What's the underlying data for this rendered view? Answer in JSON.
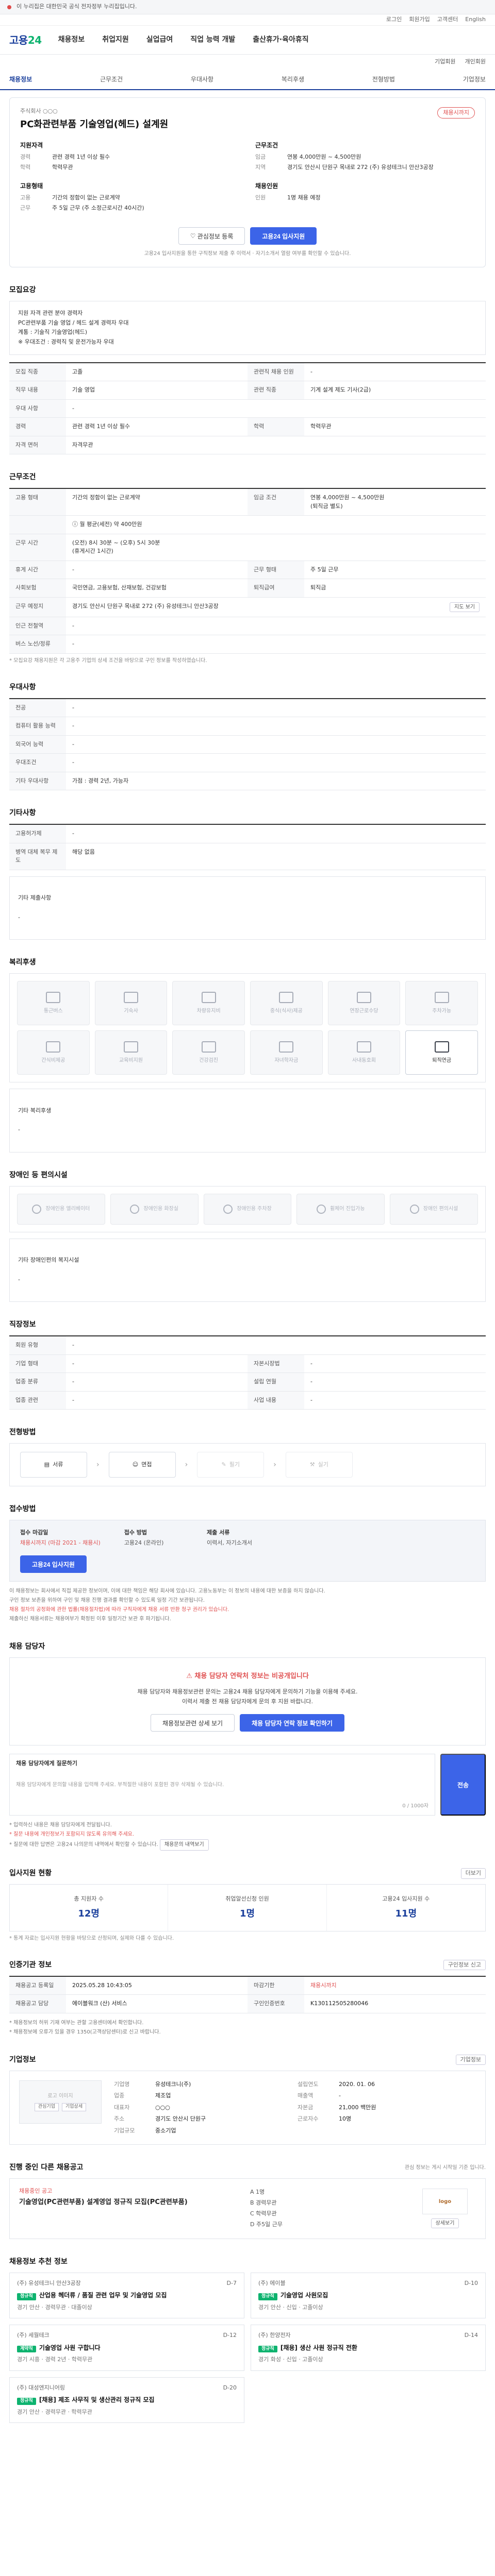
{
  "topbar": {
    "text": "이 누리집은 대한민국 공식 전자정부 누리집입니다."
  },
  "util": [
    "로그인",
    "회원가입",
    "고객센터",
    "English"
  ],
  "header": {
    "logo_main": "고용",
    "logo_accent": "24",
    "gnb": [
      "채용정보",
      "취업지원",
      "실업급여",
      "직업 능력 개발",
      "출산휴가·육아휴직"
    ]
  },
  "search": [
    "기업회원",
    "개인회원"
  ],
  "tabs": [
    "채용정보",
    "근무조건",
    "우대사항",
    "복리후생",
    "전형방법",
    "기업정보"
  ],
  "headline": {
    "company": "주식회사 ○○○",
    "title": "PC화관련부품 기술영업(헤드) 설계원",
    "dday": "채용시까지",
    "blocks": [
      {
        "title": "지원자격",
        "rows": [
          {
            "k": "경력",
            "v": "관련 경력 1년 이상 필수"
          },
          {
            "k": "학력",
            "v": "학력무관"
          }
        ]
      },
      {
        "title": "근무조건",
        "rows": [
          {
            "k": "임금",
            "v": "연봉 4,000만원 ~ 4,500만원"
          },
          {
            "k": "지역",
            "v": "경기도 안산시 단원구 목내로 272 (주) 유성테크니 안산3공장"
          }
        ]
      },
      {
        "title": "고용형태",
        "rows": [
          {
            "k": "고용",
            "v": "기간의 정함이 없는 근로계약"
          },
          {
            "k": "근무",
            "v": "주 5일 근무 (주 소정근로시간 40시간)"
          }
        ]
      },
      {
        "title": "채용인원",
        "rows": [
          {
            "k": "인원",
            "v": "1명 채용 예정"
          }
        ]
      }
    ],
    "actions": {
      "save": "관심정보 등록",
      "apply": "고용24 입사지원"
    },
    "note": "고용24 입사지원을 통한 구직정보 제출 후 이력서 · 자기소개서 열람 여부를 확인할 수 있습니다."
  },
  "job_desc": {
    "title": "모집요강",
    "text": "지원 자격 관련 분야 경력자\nPC관련부품 기술 영업 / 헤드 설계 경력자 우대\n계통 : 기술직 기술영업(헤드)\n※ 우대조건 : 경력직 및 운전가능자 우대",
    "rows": [
      {
        "th": "모집 직종",
        "td": "고졸",
        "th2": "관련직 채용 인원",
        "td2": "-"
      },
      {
        "th": "직무 내용",
        "td": "기술 영업",
        "th2": "관련 직종",
        "td2": "기계 설계 제도 기사(2급)"
      },
      {
        "th": "우대 사항",
        "td": "-",
        "th2": "",
        "td2": ""
      },
      {
        "th": "경력",
        "td": "관련 경력 1년 이상 필수",
        "th2": "학력",
        "td2": "학력무관"
      },
      {
        "th": "자격 면허",
        "td": "자격무관",
        "th2": "",
        "td2": ""
      }
    ]
  },
  "conditions": {
    "title": "근무조건",
    "rows": [
      {
        "th": "고용 형태",
        "td": "기간의 정함이 없는 근로계약",
        "th2": "임금 조건",
        "td2": "연봉 4,000만원 ~ 4,500만원\n(퇴직금 별도)"
      }
    ],
    "wage_note": "월 평균(세전) 약 400만원",
    "rows2": [
      {
        "th": "근무 시간",
        "td": "(오전) 8시 30분 ~ (오후) 5시 30분\n(휴게시간 1시간)"
      },
      {
        "th": "휴게 시간",
        "td": "-",
        "th2": "근무 형태",
        "td2": "주 5일 근무"
      },
      {
        "th": "사회보험",
        "td": "국민연금, 고용보험, 산재보험, 건강보험",
        "th2": "퇴직급여",
        "td2": "퇴직금"
      },
      {
        "th": "근무 예정지",
        "td": "경기도 안산시 단원구 목내로 272 (주) 유성테크니 안산3공장",
        "th2": "",
        "td2": ""
      },
      {
        "th": "인근 전철역",
        "td": "-",
        "th2": "",
        "td2": ""
      },
      {
        "th": "버스 노선/정류",
        "td": "-",
        "th2": "",
        "td2": ""
      }
    ],
    "map_btn": "지도 보기",
    "note": "* 모집요강 채용지원은 각 고용주 기업의 상세 조건을 바탕으로 구인 정보를 작성하였습니다."
  },
  "prefer": {
    "title": "우대사항",
    "rows": [
      {
        "th": "전공",
        "td": "-"
      },
      {
        "th": "컴퓨터 활용 능력",
        "td": "-"
      },
      {
        "th": "외국어 능력",
        "td": "-"
      },
      {
        "th": "우대조건",
        "td": "-"
      },
      {
        "th": "기타 우대사항",
        "td": "가점 : 경력 2년, 가능자"
      }
    ]
  },
  "etc": {
    "title": "기타사항",
    "rows": [
      {
        "th": "고용허가제",
        "td": "-"
      },
      {
        "th": "병역 대체 복무 제도",
        "td": "해당 없음"
      }
    ],
    "extra_label": "기타 제출사항",
    "extra_value": "-"
  },
  "welfare": {
    "title": "복리후생",
    "items": [
      {
        "label": "통근버스",
        "on": false
      },
      {
        "label": "기숙사",
        "on": false
      },
      {
        "label": "차량유지비",
        "on": false
      },
      {
        "label": "중식(식사)제공",
        "on": false
      },
      {
        "label": "연장근로수당",
        "on": false
      },
      {
        "label": "주차가능",
        "on": false
      },
      {
        "label": "간식비제공",
        "on": false
      },
      {
        "label": "교육비지원",
        "on": false
      },
      {
        "label": "건강검진",
        "on": false
      },
      {
        "label": "자녀학자금",
        "on": false
      },
      {
        "label": "사내동호회",
        "on": false
      },
      {
        "label": "퇴직연금",
        "on": true
      }
    ],
    "extra_label": "기타 복리후생",
    "extra_value": "-"
  },
  "disability": {
    "title": "장애인 등 편의시설",
    "items": [
      "장애인용 엘리베이터",
      "장애인용 화장실",
      "장애인용 주차장",
      "휠체어 진입가능",
      "장애인 편의시설"
    ],
    "extra_label": "기타 장애인편의 복지시설",
    "extra_value": "-"
  },
  "location": {
    "title": "직장정보",
    "rows": [
      {
        "th": "회원 유형",
        "td": "-"
      },
      {
        "th": "기업 형태",
        "td": "-",
        "th2": "자본시장법",
        "td2": "-"
      },
      {
        "th": "업종 분류",
        "td": "-",
        "th2": "설립 연월",
        "td2": "-"
      },
      {
        "th": "업종 관련",
        "td": "-",
        "th2": "사업 내용",
        "td2": "-"
      }
    ]
  },
  "process": {
    "title": "전형방법",
    "steps": [
      {
        "label": "서류",
        "on": true
      },
      {
        "label": "면접",
        "on": true
      },
      {
        "label": "필기",
        "on": false
      },
      {
        "label": "실기",
        "on": false
      }
    ]
  },
  "apply": {
    "title": "접수방법",
    "cols": [
      {
        "h": "접수 마감일",
        "p": "채용시까지 (마감 2021 - 채용시)",
        "red": true
      },
      {
        "h": "접수 방법",
        "p": "고용24 (온라인)",
        "red": false
      }
    ],
    "cols2": [
      {
        "h": "제출 서류",
        "p": "이력서, 자기소개서",
        "red": false
      }
    ],
    "button": "고용24 입사지원",
    "notices": [
      {
        "t": "이 채용정보는 회사에서 직접 제공한 정보이며, 이에 대한 책임은 해당 회사에 있습니다. 고용노동부는 이 정보의 내용에 대한 보증을 하지 않습니다.",
        "red": false
      },
      {
        "t": "구인 정보 보존을 위하여 구인 및 채용 진행 결과를 확인할 수 있도록 일정 기간 보관됩니다.",
        "red": false
      },
      {
        "t": "채용 절차의 공정화에 관한 법률(채용절차법)에 따라 구직자에게 채용 서류 반환 청구 권리가 있습니다.",
        "red": true
      },
      {
        "t": "제출하신 채용서류는 채용여부가 확정된 이후 일정기간 보관 후 파기됩니다.",
        "red": false
      }
    ]
  },
  "consult": {
    "title": "채용 담당자",
    "headline": "채용 담당자 연락처 정보는 비공개입니다",
    "lines": [
      "채용 담당자와 채용정보관련 문의는 고용24 채용 담당자에게 문의하기 기능을 이용해 주세요.",
      "이력서 제출 전 채용 담당자에게 문의 후 지원 바랍니다."
    ],
    "btn1": "채용정보관련 상세 보기",
    "btn2": "채용 담당자 연락 정보 확인하기",
    "q_label": "채용 담당자에게 질문하기",
    "q_placeholder": "채용 담당자에게 문의할 내용을 입력해 주세요. 부적절한 내용이 포함된 경우 삭제될 수 있습니다.",
    "q_count": "0 / 1000자",
    "q_send": "전송",
    "q_notes": [
      "* 입력하신 내용은 채용 담당자에게 전달됩니다.",
      "* 질문 내용에 개인정보가 포함되지 않도록 유의해 주세요.",
      "* 질문에 대한 답변은 고용24 나의문의 내역에서 확인할 수 있습니다."
    ],
    "q_more": "채용문의 내역보기"
  },
  "stats": {
    "title": "입사지원 현황",
    "more": "더보기",
    "items": [
      {
        "lab": "총 지원자 수",
        "val": "12명"
      },
      {
        "lab": "취업알선신청 인원",
        "val": "1명"
      },
      {
        "lab": "고용24 입사지원 수",
        "val": "11명"
      }
    ],
    "note": "* 통계 자료는 입사지원 현황을 바탕으로 산정되며, 실제와 다를 수 있습니다."
  },
  "registration": {
    "title": "인증기관 정보",
    "more": "구인정보 신고",
    "cells": [
      {
        "th": "채용공고 등록일",
        "td": "2025.05.28 10:43:05",
        "th2": "마감기한",
        "td2": "채용시까지",
        "red2": true
      },
      {
        "th": "채용공고 담당",
        "td": "에이블워크 (산) 서비스",
        "th2": "구인인증번호",
        "td2": "K130112505280046",
        "red2": false
      }
    ],
    "notes": [
      "* 채용정보의 허위 기재 여부는 관할 고용센터에서 확인합니다.",
      "* 채용정보에 오류가 있을 경우 1350(고객상담센터)로 신고 바랍니다."
    ]
  },
  "company": {
    "title": "기업정보",
    "more": "기업정보",
    "logo_text": "로고 이미지",
    "mini": [
      "관심기업",
      "기업상세"
    ],
    "info": [
      {
        "k": "기업명",
        "v": "유성테크니(주)"
      },
      {
        "k": "설립연도",
        "v": "2020. 01. 06"
      },
      {
        "k": "업종",
        "v": "제조업"
      },
      {
        "k": "매출액",
        "v": "-"
      },
      {
        "k": "대표자",
        "v": "○○○"
      },
      {
        "k": "자본금",
        "v": "21,000 백만원"
      },
      {
        "k": "주소",
        "v": "경기도 안산시 단원구"
      },
      {
        "k": "근로자수",
        "v": "10명"
      },
      {
        "k": "기업규모",
        "v": "중소기업"
      },
      {
        "k": "",
        "v": ""
      }
    ]
  },
  "others": {
    "title": "진행 중인 다른 채용공고",
    "note": "관심 정보는 게시 시작일 기준 입니다.",
    "company": "채용중인 공고",
    "job_title": "기술영업(PC관련부품) 설계영업 정규직 모집(PC관련부품)",
    "meta": [
      "A 1명",
      "B 경력무관",
      "C 학력무관",
      "D 주5일 근무"
    ],
    "logo": "logo",
    "btn": "상세보기"
  },
  "recommend": {
    "title": "채용정보 추천 정보",
    "cards": [
      {
        "co": "(주) 유성테크니 안산3공장",
        "badge": "정규직",
        "ttl": "산업용 헤더류 / 품질 관련 업무 및 기술영업 모집",
        "meta": "경기 안산 · 경력무관 · 대졸이상",
        "d": "D-7"
      },
      {
        "co": "(주) 에이블",
        "badge": "정규직",
        "ttl": "기술영업 사원모집",
        "meta": "경기 안산 · 신입 · 고졸이상",
        "d": "D-10"
      },
      {
        "co": "(주) 세월테크",
        "badge": "계약직",
        "ttl": "기술영업 사원 구합니다",
        "meta": "경기 시흥 · 경력 2년 · 학력무관",
        "d": "D-12"
      },
      {
        "co": "(주) 한양전자",
        "badge": "정규직",
        "ttl": "[채용] 생산 사원 정규직 전환",
        "meta": "경기 화성 · 신입 · 고졸이상",
        "d": "D-14"
      },
      {
        "co": "(주) 대성엔지니어링",
        "badge": "정규직",
        "ttl": "[채용] 제조 사무직 및 생산관리 정규직 모집",
        "meta": "경기 안산 · 경력무관 · 학력무관",
        "d": "D-20"
      },
      {
        "co": "",
        "badge": "",
        "ttl": "",
        "meta": "",
        "d": ""
      }
    ]
  }
}
